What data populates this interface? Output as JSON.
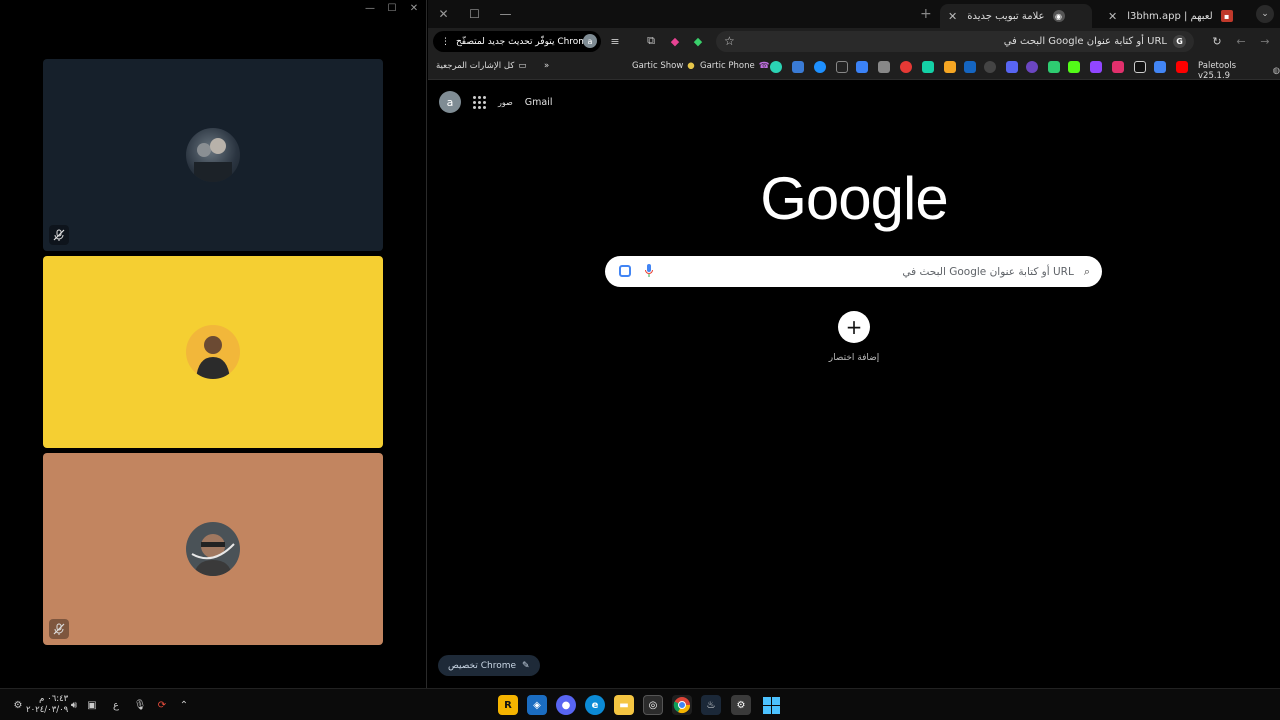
{
  "call_window": {
    "controls": [
      "—",
      "☐",
      "✕"
    ],
    "tiles": [
      {
        "color": "#16202b",
        "muted": true
      },
      {
        "color": "#f5cf32",
        "muted": false
      },
      {
        "color": "#c28560",
        "muted": true
      }
    ]
  },
  "chrome": {
    "window_controls": [
      "✕",
      "☐",
      "—"
    ],
    "new_tab": "+",
    "tabs": [
      {
        "title": "علامة تبويب جديدة",
        "active": true
      },
      {
        "title": "l3bhm.app | لعبهم",
        "active": false
      }
    ],
    "tab_search_icon": "⌄",
    "update_button": "يتوفّر تحديث جديد لمتصفّح Chrome",
    "omnibox_text": "البحث في Google أو كتابة عنوان URL",
    "bookmarks": {
      "all_bookmarks": "كل الإشارات المرجعية",
      "overflow": "»",
      "gartic_show": "Gartic Show",
      "gartic_phone": "Gartic Phone",
      "paletools": "Paletools v25.1.9"
    },
    "ntp": {
      "account_initial": "a",
      "images_link": "صور",
      "gmail_link": "Gmail",
      "logo": "Google",
      "search_placeholder": "البحث في Google أو كتابة عنوان URL",
      "add_shortcut_label": "إضافة اختصار",
      "customize_label": "تخصيص Chrome"
    }
  },
  "taskbar": {
    "time": "٠٦:٤٣ م",
    "date": "٢٠٢٤/٠٣/٠٩",
    "lang": "ع",
    "up_arrow": "⌃"
  }
}
